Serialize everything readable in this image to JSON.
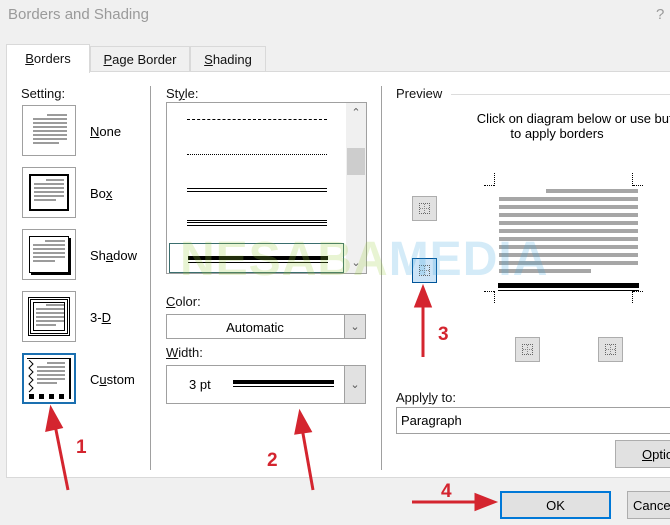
{
  "window": {
    "title": "Borders and Shading",
    "help": "?"
  },
  "tabs": [
    {
      "label_u": "B",
      "label_rest": "orders",
      "active": true
    },
    {
      "label_u": "P",
      "label_rest": "age Border",
      "active": false
    },
    {
      "label_u": "S",
      "label_rest": "hading",
      "active": false
    }
  ],
  "setting": {
    "label": "Setting:",
    "items": [
      {
        "pre": "",
        "u": "N",
        "post": "one",
        "selected": false
      },
      {
        "pre": "Bo",
        "u": "x",
        "post": "",
        "selected": false
      },
      {
        "pre": "Sh",
        "u": "a",
        "post": "dow",
        "selected": false
      },
      {
        "pre": "3-",
        "u": "D",
        "post": "",
        "selected": false
      },
      {
        "pre": "C",
        "u": "u",
        "post": "stom",
        "selected": true
      }
    ]
  },
  "style": {
    "label_pre": "St",
    "label_u": "y",
    "label_post": "le:",
    "items": [
      "dash-dot",
      "dash-dot-dot",
      "double",
      "triple",
      "thick-thin"
    ],
    "selected": "thick-thin"
  },
  "color": {
    "label_u": "C",
    "label_rest": "olor:",
    "value": "Automatic"
  },
  "width": {
    "label_u": "W",
    "label_rest": "idth:",
    "value": "3 pt"
  },
  "preview": {
    "label": "Preview",
    "instruction_line1": "Click on diagram below or use buttons",
    "instruction_line2": "to apply borders",
    "buttons": [
      "top-border",
      "bottom-border",
      "left-border",
      "right-border"
    ],
    "active_button": "bottom-border"
  },
  "apply_to": {
    "label_pre": "Apply",
    "label_u": "l",
    "label_post": "y to:",
    "value": "Paragraph"
  },
  "buttons": {
    "options_u": "O",
    "options_rest": "ptions...",
    "ok": "OK",
    "cancel": "Cancel"
  },
  "annotations": [
    "1",
    "2",
    "3",
    "4"
  ],
  "annotation_color": "#d4252f",
  "watermark": {
    "part1": "NESABA",
    "part2": "MEDIA"
  }
}
